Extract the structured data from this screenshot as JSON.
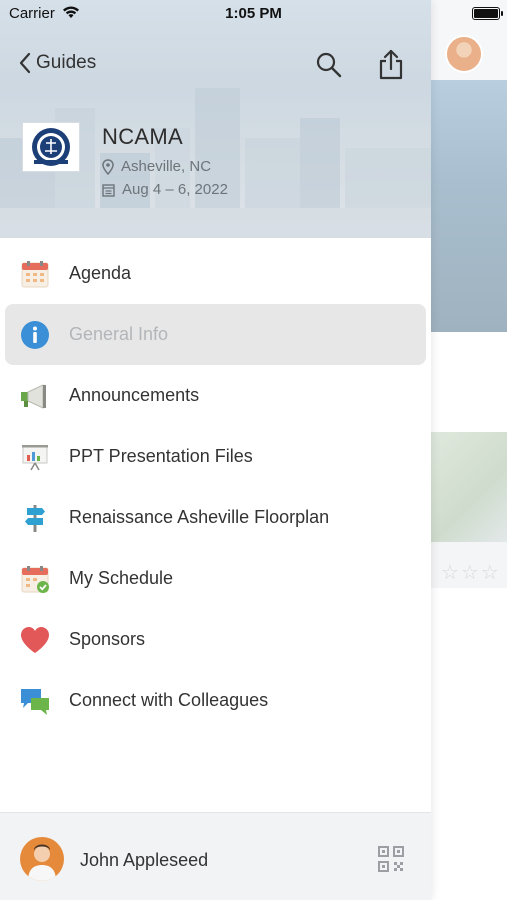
{
  "status_bar": {
    "carrier": "Carrier",
    "time": "1:05 PM"
  },
  "nav": {
    "back_label": "Guides"
  },
  "event": {
    "title": "NCAMA",
    "location": "Asheville, NC",
    "dates": "Aug 4 – 6, 2022"
  },
  "menu": {
    "items": [
      {
        "label": "Agenda",
        "icon": "calendar-icon"
      },
      {
        "label": "General Info",
        "icon": "info-icon",
        "selected": true
      },
      {
        "label": "Announcements",
        "icon": "megaphone-icon"
      },
      {
        "label": "PPT Presentation Files",
        "icon": "presentation-icon"
      },
      {
        "label": "Renaissance Asheville Floorplan",
        "icon": "signpost-icon"
      },
      {
        "label": "My Schedule",
        "icon": "schedule-calendar-icon"
      },
      {
        "label": "Sponsors",
        "icon": "heart-icon"
      },
      {
        "label": "Connect with Colleagues",
        "icon": "chat-bubbles-icon"
      }
    ]
  },
  "footer": {
    "user_name": "John Appleseed"
  },
  "colors": {
    "info_blue": "#3a8fd6",
    "heart_red": "#e25757",
    "selected_bg": "#e7e7e8"
  }
}
